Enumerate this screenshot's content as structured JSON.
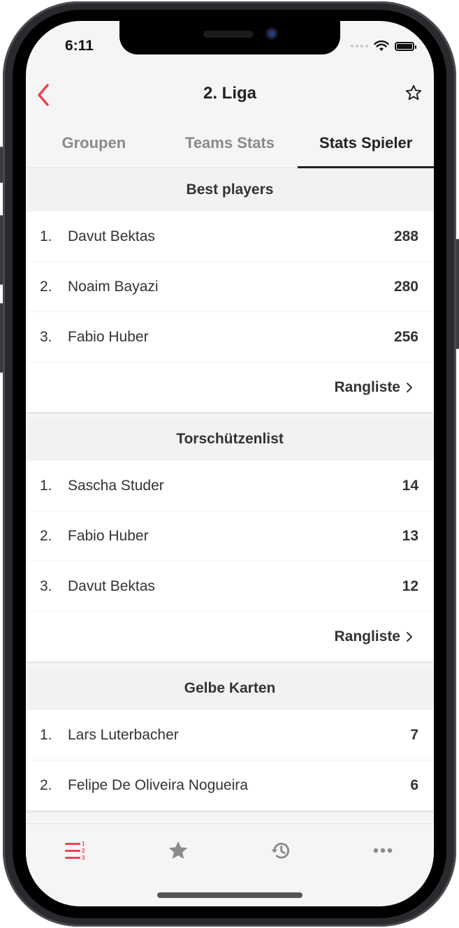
{
  "status_bar": {
    "time": "6:11"
  },
  "navbar": {
    "title": "2. Liga",
    "back_icon": "chevron-left-icon",
    "favorite_icon": "star-outline-icon"
  },
  "tabs": [
    {
      "label": "Groupen",
      "active": false
    },
    {
      "label": "Teams Stats",
      "active": false
    },
    {
      "label": "Stats Spieler",
      "active": true
    }
  ],
  "sections": [
    {
      "title": "Best players",
      "rows": [
        {
          "rank": "1.",
          "name": "Davut Bektas",
          "value": "288"
        },
        {
          "rank": "2.",
          "name": "Noaim Bayazi",
          "value": "280"
        },
        {
          "rank": "3.",
          "name": "Fabio Huber",
          "value": "256"
        }
      ],
      "more_label": "Rangliste"
    },
    {
      "title": "Torschützenlist",
      "rows": [
        {
          "rank": "1.",
          "name": "Sascha Studer",
          "value": "14"
        },
        {
          "rank": "2.",
          "name": "Fabio Huber",
          "value": "13"
        },
        {
          "rank": "3.",
          "name": "Davut Bektas",
          "value": "12"
        }
      ],
      "more_label": "Rangliste"
    },
    {
      "title": "Gelbe Karten",
      "rows": [
        {
          "rank": "1.",
          "name": "Lars Luterbacher",
          "value": "7"
        },
        {
          "rank": "2.",
          "name": "Felipe De Oliveira Nogueira",
          "value": "6"
        }
      ]
    }
  ],
  "tabbar": [
    {
      "icon": "ranking-list-icon",
      "active": true
    },
    {
      "icon": "star-icon",
      "active": false
    },
    {
      "icon": "history-icon",
      "active": false
    },
    {
      "icon": "more-icon",
      "active": false
    }
  ],
  "colors": {
    "accent": "#f0414f",
    "inactive": "#8a8a8a",
    "text": "#333333"
  }
}
